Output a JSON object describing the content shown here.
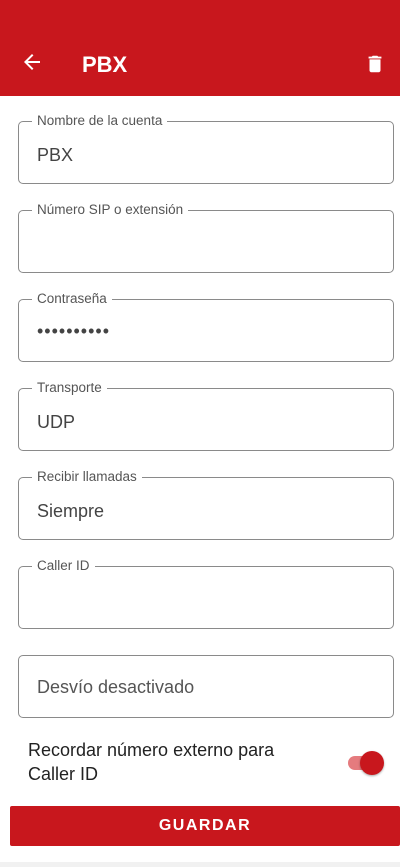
{
  "appbar": {
    "title": "PBX",
    "back_icon": "arrow-left-icon",
    "delete_icon": "trash-icon",
    "color": "#c8171d"
  },
  "form": {
    "account_name": {
      "label": "Nombre de la cuenta",
      "value": "PBX"
    },
    "sip_number": {
      "label": "Número SIP o extensión",
      "value": ""
    },
    "password": {
      "label": "Contraseña",
      "value": "••••••••••"
    },
    "transport": {
      "label": "Transporte",
      "value": "UDP"
    },
    "receive_calls": {
      "label": "Recibir llamadas",
      "value": "Siempre"
    },
    "caller_id": {
      "label": "Caller ID",
      "value": ""
    },
    "forwarding": {
      "value": "Desvío desactivado"
    }
  },
  "toggle": {
    "label": "Recordar número externo para Caller ID",
    "on": true
  },
  "save_button": {
    "label": "GUARDAR"
  }
}
